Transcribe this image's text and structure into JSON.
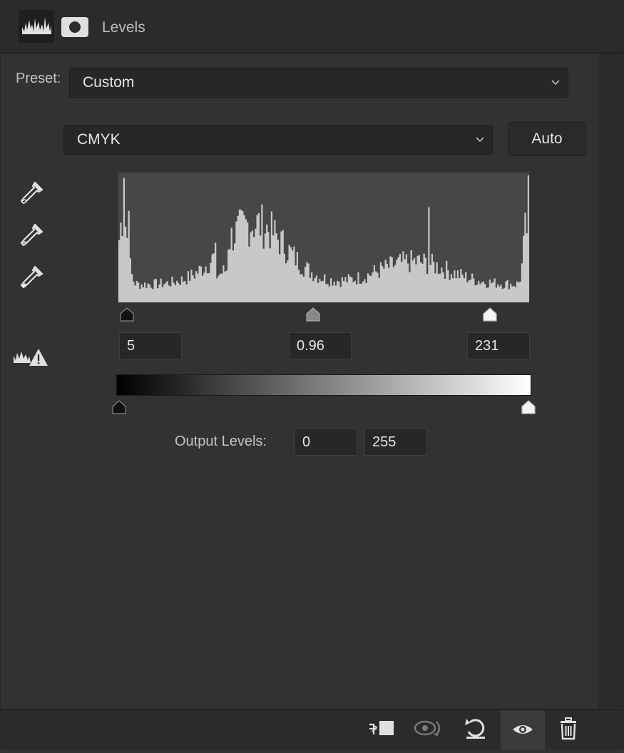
{
  "header": {
    "title": "Levels",
    "icons": [
      "levels-adjustment-icon",
      "layer-mask-icon"
    ]
  },
  "preset": {
    "label": "Preset:",
    "value": "Custom"
  },
  "channel": {
    "value": "CMYK"
  },
  "auto_button": {
    "label": "Auto"
  },
  "eyedroppers": [
    "black-point-eyedropper-icon",
    "gray-point-eyedropper-icon",
    "white-point-eyedropper-icon"
  ],
  "input_levels": {
    "shadow": "5",
    "midtone": "0.96",
    "highlight": "231"
  },
  "output_levels": {
    "label": "Output Levels:",
    "low": "0",
    "high": "255"
  },
  "footer_icons": [
    "clip-to-layer-icon",
    "view-previous-state-icon",
    "reset-icon",
    "visibility-eye-icon",
    "trash-icon"
  ],
  "colors": {
    "panel_bg": "#323232",
    "header_bg": "#2b2b2b",
    "histogram_bg": "#474747",
    "histogram_fill": "#c8c8c8"
  }
}
